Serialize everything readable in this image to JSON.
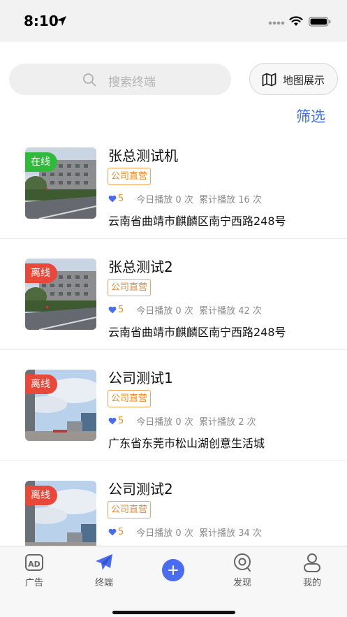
{
  "status_bar": {
    "time": "8:10"
  },
  "search": {
    "placeholder": "搜索终端"
  },
  "map_button": {
    "label": "地图展示"
  },
  "filter": {
    "label": "筛选"
  },
  "devices": [
    {
      "name": "张总测试机",
      "status": "在线",
      "status_color": "#2fba3c",
      "tag": "公司直营",
      "likes": "5",
      "stats": "今日播放 0 次  累计播放 16 次",
      "address": "云南省曲靖市麒麟区南宁西路248号"
    },
    {
      "name": "张总测试2",
      "status": "离线",
      "status_color": "#e8483a",
      "tag": "公司直营",
      "likes": "5",
      "stats": "今日播放 0 次  累计播放 42 次",
      "address": "云南省曲靖市麒麟区南宁西路248号"
    },
    {
      "name": "公司测试1",
      "status": "离线",
      "status_color": "#e8483a",
      "tag": "公司直营",
      "likes": "5",
      "stats": "今日播放 0 次  累计播放 2 次",
      "address": "广东省东莞市松山湖创意生活城"
    },
    {
      "name": "公司测试2",
      "status": "离线",
      "status_color": "#e8483a",
      "tag": "公司直营",
      "likes": "5",
      "stats": "今日播放 0 次  累计播放 34 次",
      "address": ""
    }
  ],
  "tabbar": {
    "items": [
      {
        "label": "广告",
        "icon": "ad-icon"
      },
      {
        "label": "终端",
        "icon": "paper-plane-icon"
      },
      {
        "label": "",
        "icon": "plus-icon"
      },
      {
        "label": "发现",
        "icon": "discover-icon"
      },
      {
        "label": "我的",
        "icon": "user-icon"
      }
    ]
  },
  "colors": {
    "accent": "#4a6cf0",
    "online": "#2fba3c",
    "offline": "#e8483a",
    "tag": "#ef8a2a"
  }
}
